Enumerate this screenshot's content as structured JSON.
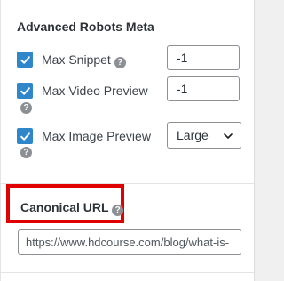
{
  "robots_meta": {
    "title": "Advanced Robots Meta",
    "max_snippet": {
      "label": "Max Snippet",
      "checked": true,
      "value": "-1"
    },
    "max_video_preview": {
      "label": "Max Video Preview",
      "checked": true,
      "value": "-1"
    },
    "max_image_preview": {
      "label": "Max Image Preview",
      "checked": true,
      "selected": "Large"
    }
  },
  "canonical": {
    "title": "Canonical URL",
    "value": "https://www.hdcourse.com/blog/what-is-"
  },
  "icons": {
    "help": "?",
    "check": "checkmark-icon",
    "chevron": "chevron-down-icon"
  },
  "colors": {
    "checkbox": "#2f86c9",
    "highlight": "#e00000",
    "help_icon": "#8c8f94"
  }
}
